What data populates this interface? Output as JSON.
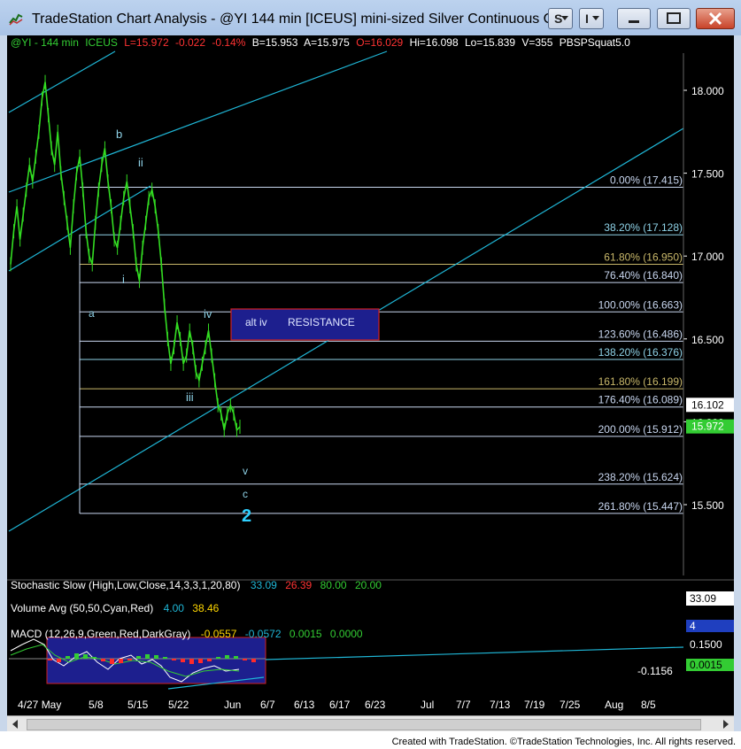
{
  "window": {
    "title": "TradeStation Chart Analysis - @YI 144 min [ICEUS] mini-sized Silver Continuous Co...",
    "buttons": {
      "s_label": "S",
      "i_label": "I"
    }
  },
  "header": {
    "symbol": "@YI - 144 min",
    "exchange": "ICEUS",
    "last": "L=15.972",
    "change": "-0.022",
    "change_pct": "-0.14%",
    "bid": "B=15.953",
    "ask": "A=15.975",
    "open": "O=16.029",
    "high": "Hi=16.098",
    "low": "Lo=15.839",
    "volume": "V=355",
    "study": "PBSPSquat5.0"
  },
  "colors": {
    "background": "#000000",
    "price": "#33dd22",
    "fib_line": "#c9d7f0",
    "channel": "#1fb6d6",
    "wave_label": "#8fd3e8",
    "resistance_fill": "#1d1f8e",
    "resistance_border": "#d02020",
    "info_green": "#33cc33",
    "info_red": "#ff3333",
    "info_white": "#ffffff"
  },
  "chart_data": {
    "type": "line",
    "title": "@YI 144 min [ICEUS] mini-sized Silver Continuous",
    "ylim": [
      15.25,
      18.25
    ],
    "y_ticks": [
      "18.000",
      "17.500",
      "17.000",
      "16.500",
      "16.000",
      "15.500"
    ],
    "x_ticks": [
      "4/27 May",
      "5/8",
      "5/15",
      "5/22",
      "Jun",
      "6/7",
      "6/13",
      "6/17",
      "6/23",
      "Jul",
      "7/7",
      "7/13",
      "7/19",
      "7/25",
      "Aug",
      "8/5"
    ],
    "series": [
      {
        "name": "@YI - 144 min",
        "values": [
          16.95,
          17.15,
          17.3,
          17.1,
          17.25,
          17.4,
          17.55,
          17.45,
          17.6,
          17.75,
          17.95,
          18.05,
          17.85,
          17.65,
          17.55,
          17.75,
          17.5,
          17.35,
          17.2,
          17.05,
          17.3,
          17.5,
          17.6,
          17.4,
          17.15,
          17.0,
          16.95,
          17.2,
          17.4,
          17.55,
          17.65,
          17.45,
          17.3,
          17.1,
          17.05,
          17.2,
          17.35,
          17.45,
          17.3,
          17.15,
          16.95,
          16.85,
          17.05,
          17.2,
          17.35,
          17.4,
          17.3,
          17.15,
          16.95,
          16.7,
          16.5,
          16.35,
          16.45,
          16.6,
          16.5,
          16.35,
          16.4,
          16.55,
          16.45,
          16.3,
          16.25,
          16.35,
          16.45,
          16.55,
          16.4,
          16.25,
          16.1,
          16.05,
          15.95,
          16.05,
          16.1,
          16.05,
          15.95,
          15.97
        ]
      }
    ],
    "price_markers": [
      {
        "label": "16.102",
        "value": 16.102
      },
      {
        "label": "15.972",
        "value": 15.972
      }
    ],
    "fib_levels": [
      {
        "pct": "0.00%",
        "value": "17.415",
        "label": "0.00% (17.415)"
      },
      {
        "pct": "38.20%",
        "value": "17.128",
        "label": "38.20% (17.128)"
      },
      {
        "pct": "61.80%",
        "value": "16.950",
        "label": "61.80% (16.950)"
      },
      {
        "pct": "76.40%",
        "value": "16.840",
        "label": "76.40% (16.840)"
      },
      {
        "pct": "100.00%",
        "value": "16.663",
        "label": "100.00% (16.663)"
      },
      {
        "pct": "123.60%",
        "value": "16.486",
        "label": "123.60% (16.486)"
      },
      {
        "pct": "138.20%",
        "value": "16.376",
        "label": "138.20% (16.376)"
      },
      {
        "pct": "161.80%",
        "value": "16.199",
        "label": "161.80% (16.199)"
      },
      {
        "pct": "176.40%",
        "value": "16.089",
        "label": "176.40% (16.089)"
      },
      {
        "pct": "200.00%",
        "value": "15.912",
        "label": "200.00% (15.912)"
      },
      {
        "pct": "238.20%",
        "value": "15.624",
        "label": "238.20% (15.624)"
      },
      {
        "pct": "261.80%",
        "value": "15.447",
        "label": "261.80% (15.447)"
      }
    ],
    "wave_labels": [
      "b",
      "ii",
      "i",
      "a",
      "iv",
      "iii",
      "v",
      "c",
      "2"
    ],
    "annotations": [
      "alt iv",
      "RESISTANCE"
    ]
  },
  "indicators": {
    "stochastic": {
      "label": "Stochastic Slow (High,Low,Close,14,3,3,1,20,80)",
      "v1": "33.09",
      "v2": "26.39",
      "v3": "80.00",
      "v4": "20.00",
      "axis_value": "33.09"
    },
    "volume": {
      "label": "Volume Avg (50,50,Cyan,Red)",
      "v1": "4.00",
      "v2": "38.46",
      "axis_value": "4"
    },
    "macd": {
      "label": "MACD (12,26,9,Green,Red,DarkGray)",
      "v1": "-0.0557",
      "v2": "-0.0572",
      "v3": "0.0015",
      "v4": "0.0000",
      "axis_top": "0.1500",
      "axis_hl": "0.0015",
      "axis_bottom": "-0.1156"
    }
  },
  "footer": {
    "text": "Created with TradeStation. ©TradeStation Technologies, Inc. All rights reserved."
  }
}
